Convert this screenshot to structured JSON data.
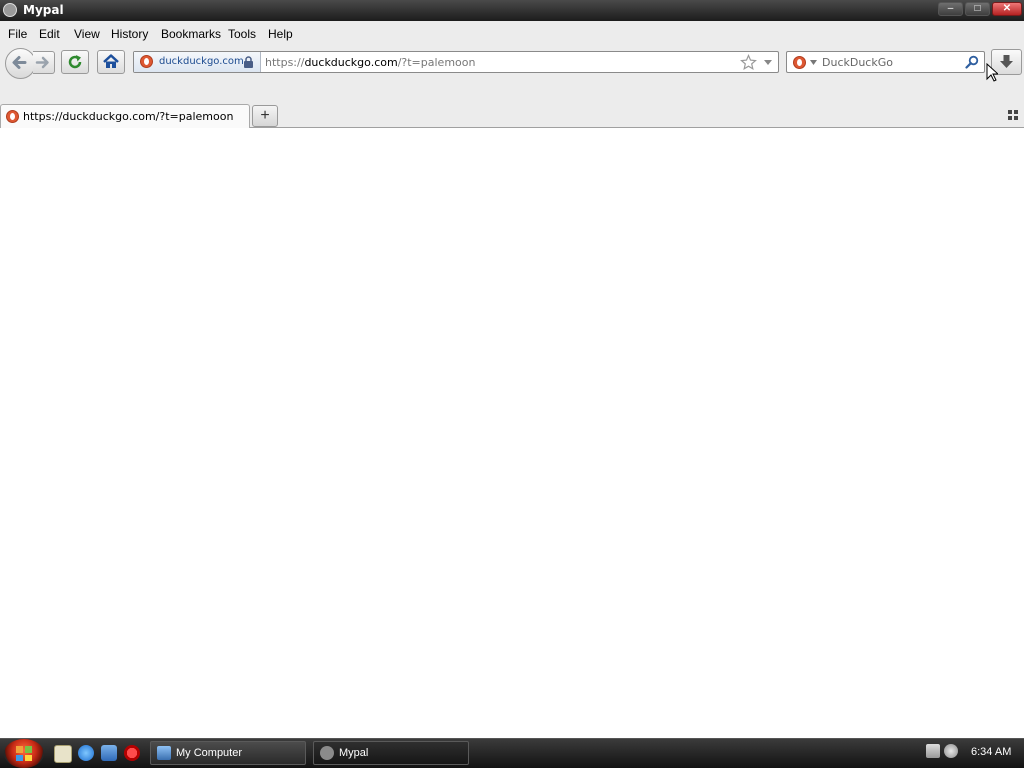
{
  "window": {
    "title": "Mypal",
    "buttons": {
      "minimize": "–",
      "maximize": "□",
      "close": "✕"
    }
  },
  "menu": [
    "File",
    "Edit",
    "View",
    "History",
    "Bookmarks",
    "Tools",
    "Help"
  ],
  "nav": {
    "identity_label": "duckduckgo.com",
    "url_prefix": "https://",
    "url_domain": "duckduckgo.com",
    "url_suffix": "/?t=palemoon"
  },
  "search": {
    "engine": "DuckDuckGo",
    "placeholder": "DuckDuckGo"
  },
  "tabs": [
    {
      "label": "https://duckduckgo.com/?t=palemoon",
      "active": true
    }
  ],
  "new_tab_label": "+",
  "taskbar": {
    "items": [
      {
        "label": "My Computer"
      },
      {
        "label": "Mypal"
      }
    ],
    "clock": "6:34 AM"
  },
  "colors": {
    "ddg_orange": "#de5833",
    "titlebar": "#2a2a2a",
    "taskbar": "#1e1e1e"
  }
}
